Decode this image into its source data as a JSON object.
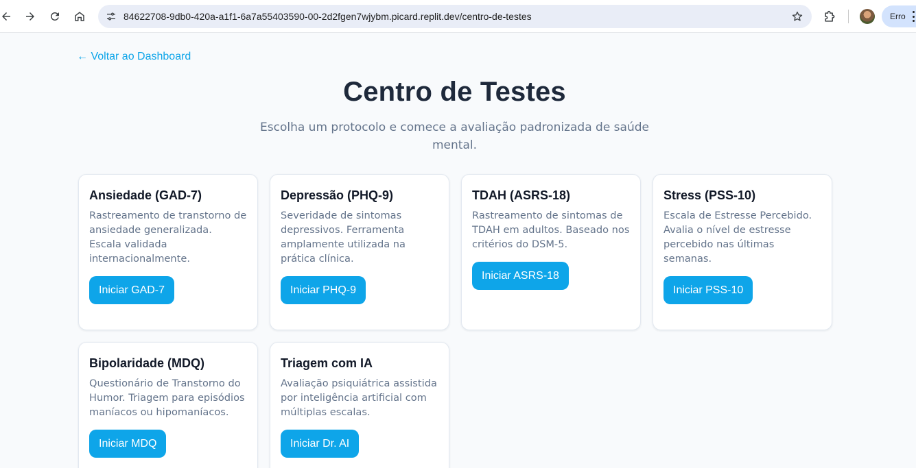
{
  "browser": {
    "url": "84622708-9db0-420a-a1f1-6a7a55403590-00-2d2fgen7wjybm.picard.replit.dev/centro-de-testes",
    "error_label": "Erro"
  },
  "page": {
    "back_link": "← Voltar ao Dashboard",
    "title": "Centro de Testes",
    "subtitle": "Escolha um protocolo e comece a avaliação padronizada de saúde mental."
  },
  "tests": [
    {
      "title": "Ansiedade (GAD-7)",
      "description": "Rastreamento de transtorno de ansiedade generalizada. Escala validada internacionalmente.",
      "button": "Iniciar GAD-7"
    },
    {
      "title": "Depressão (PHQ-9)",
      "description": "Severidade de sintomas depressivos. Ferramenta amplamente utilizada na prática clínica.",
      "button": "Iniciar PHQ-9"
    },
    {
      "title": "TDAH (ASRS-18)",
      "description": "Rastreamento de sintomas de TDAH em adultos. Baseado nos critérios do DSM-5.",
      "button": "Iniciar ASRS-18"
    },
    {
      "title": "Stress (PSS-10)",
      "description": "Escala de Estresse Percebido. Avalia o nível de estresse percebido nas últimas semanas.",
      "button": "Iniciar PSS-10"
    },
    {
      "title": "Bipolaridade (MDQ)",
      "description": "Questionário de Transtorno do Humor. Triagem para episódios maníacos ou hipomaníacos.",
      "button": "Iniciar MDQ"
    },
    {
      "title": "Triagem com IA",
      "description": "Avaliação psiquiátrica assistida por inteligência artificial com múltiplas escalas.",
      "button": "Iniciar Dr. AI"
    }
  ],
  "icons": {
    "back": "arrow-left-icon",
    "forward": "arrow-right-icon",
    "reload": "reload-icon",
    "home": "home-icon",
    "site_info": "tune-icon",
    "bookmark": "star-icon",
    "extensions": "puzzle-icon",
    "menu": "kebab-icon"
  },
  "colors": {
    "accent": "#0ea5e9",
    "page_bg": "#f8fafc",
    "title": "#1e293b",
    "muted": "#64748b"
  }
}
